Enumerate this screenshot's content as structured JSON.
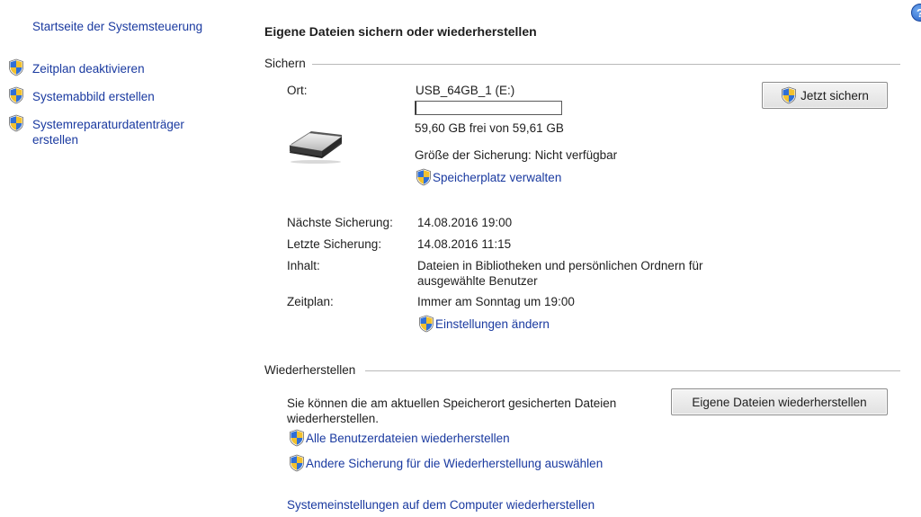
{
  "sidebar": {
    "home_link": "Startseite der Systemsteuerung",
    "tasks": [
      {
        "label": "Zeitplan deaktivieren"
      },
      {
        "label": "Systemabbild erstellen"
      },
      {
        "label_line1": "Systemreparaturdatenträger",
        "label_line2": "erstellen"
      }
    ]
  },
  "main": {
    "title": "Eigene Dateien sichern oder wiederherstellen",
    "backup": {
      "group_label": "Sichern",
      "location_label": "Ort:",
      "location_value": "USB_64GB_1 (E:)",
      "usage_fraction": 0.003,
      "free_space": "59,60 GB frei von 59,61 GB",
      "backup_size": "Größe der Sicherung: Nicht verfügbar",
      "manage_space_link": "Speicherplatz verwalten",
      "backup_now_button": "Jetzt sichern",
      "next_backup_label": "Nächste Sicherung:",
      "next_backup_value": "14.08.2016 19:00",
      "last_backup_label": "Letzte Sicherung:",
      "last_backup_value": "14.08.2016 11:15",
      "content_label": "Inhalt:",
      "content_value_line1": "Dateien in Bibliotheken und persönlichen Ordnern für",
      "content_value_line2": "ausgewählte Benutzer",
      "schedule_label": "Zeitplan:",
      "schedule_value": "Immer am Sonntag um 19:00",
      "change_settings_link": "Einstellungen ändern"
    },
    "restore": {
      "group_label": "Wiederherstellen",
      "description_line1": "Sie können die am aktuellen Speicherort gesicherten Dateien",
      "description_line2": "wiederherstellen.",
      "restore_button": "Eigene Dateien wiederherstellen",
      "all_users_link": "Alle Benutzerdateien wiederherstellen",
      "other_backup_link": "Andere Sicherung für die Wiederherstellung auswählen",
      "system_settings_link": "Systemeinstellungen auf dem Computer wiederherstellen"
    }
  },
  "help_icon_glyph": "?",
  "icons": {
    "shield": "uac-shield-icon",
    "drive": "usb-drive-icon",
    "help": "help-icon"
  }
}
